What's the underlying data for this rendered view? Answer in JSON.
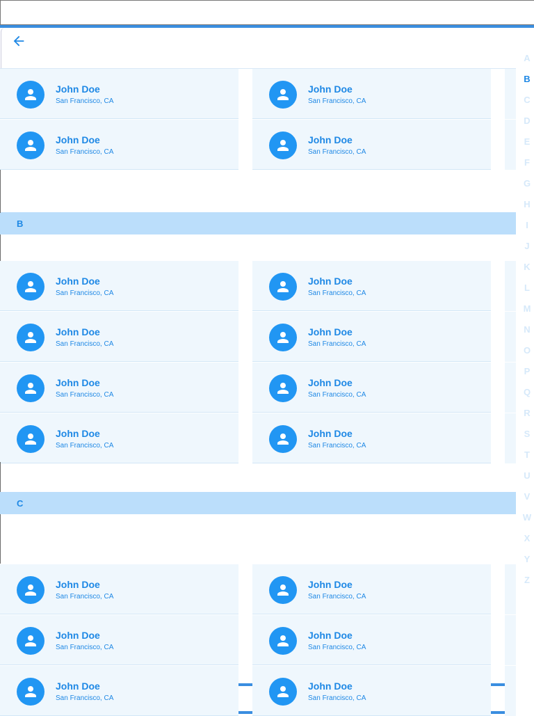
{
  "header": {
    "back_icon": "arrow-left-icon"
  },
  "sections": [
    {
      "letter": "B"
    },
    {
      "letter": "C"
    }
  ],
  "contacts": {
    "name": "John Doe",
    "location": "San Francisco, CA"
  },
  "alphabet_index": {
    "active": "B",
    "letters": [
      "A",
      "B",
      "C",
      "D",
      "E",
      "F",
      "G",
      "H",
      "I",
      "J",
      "K",
      "L",
      "M",
      "N",
      "O",
      "P",
      "Q",
      "R",
      "S",
      "T",
      "U",
      "V",
      "W",
      "X",
      "Y",
      "Z"
    ]
  },
  "colors": {
    "accent": "#1e88e5",
    "avatar": "#2196f3",
    "card_bg": "#eff7fd",
    "section_bg": "#bbdefb",
    "index_inactive": "#d6e9fa"
  }
}
